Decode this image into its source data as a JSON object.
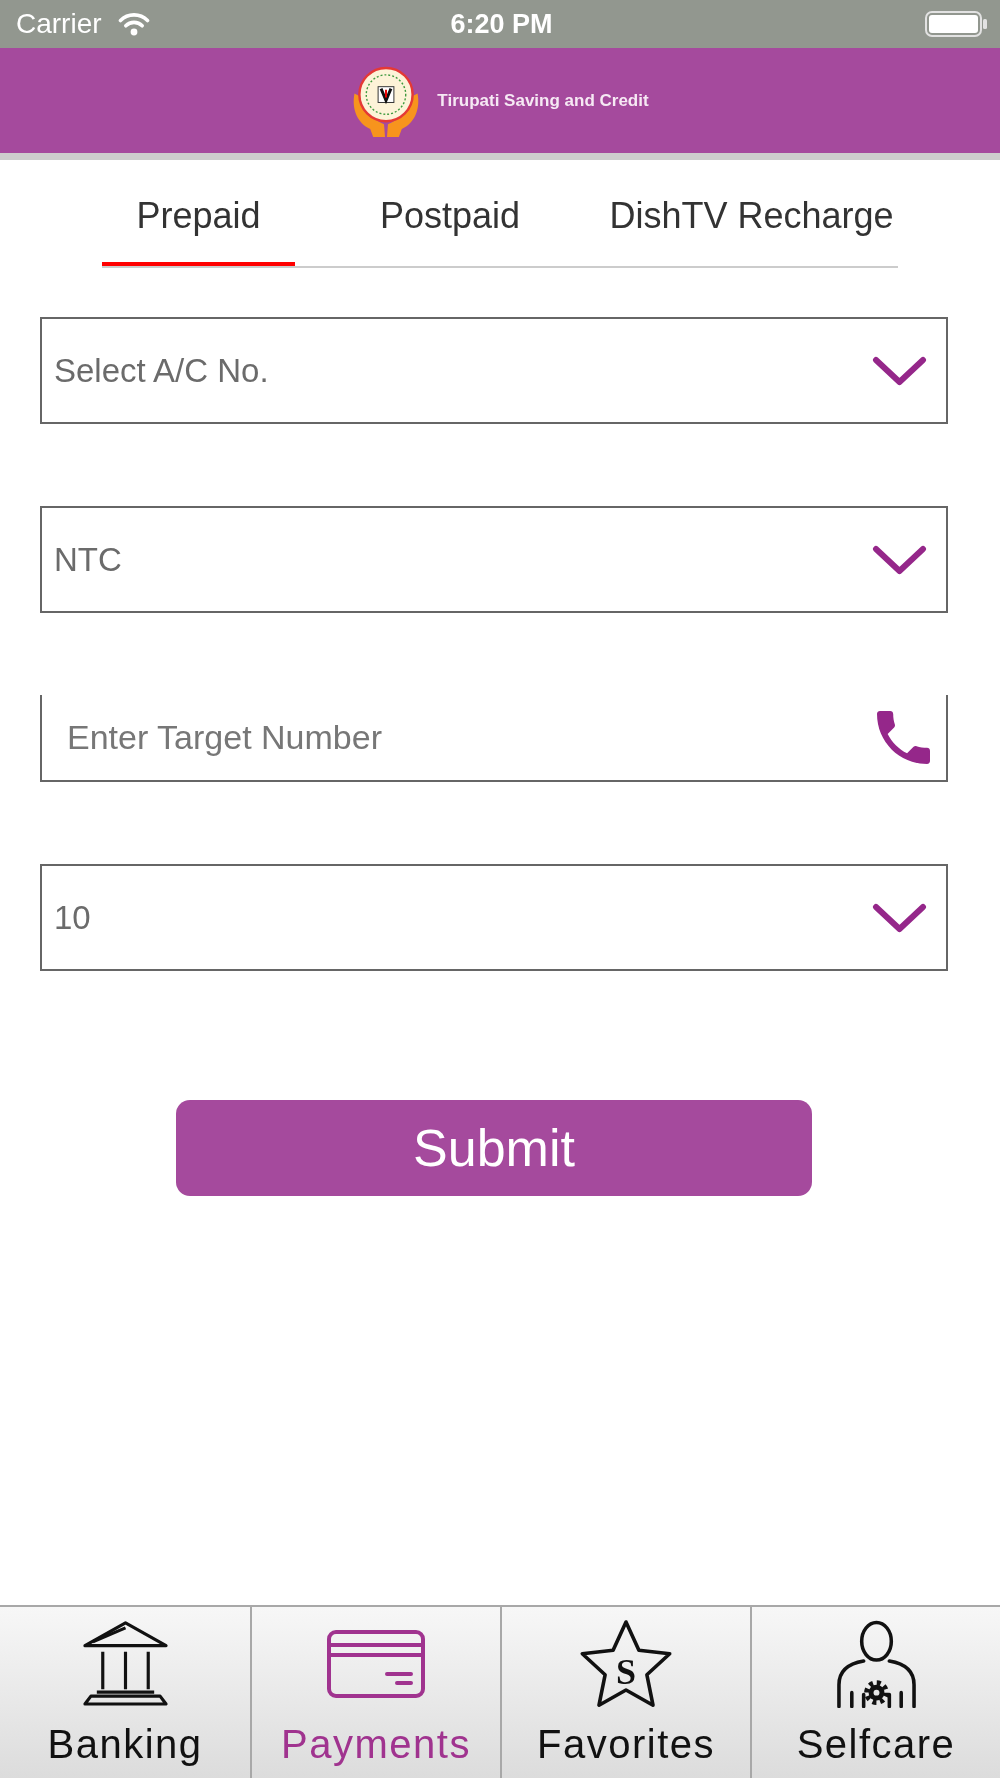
{
  "status_bar": {
    "carrier": "Carrier",
    "time": "6:20 PM"
  },
  "header": {
    "title": "Tirupati Saving and Credit"
  },
  "tabs": [
    {
      "label": "Prepaid",
      "selected": true
    },
    {
      "label": "Postpaid",
      "selected": false
    },
    {
      "label": "DishTV Recharge",
      "selected": false
    }
  ],
  "form": {
    "fields": [
      {
        "kind": "select",
        "value": "Select A/C No."
      },
      {
        "kind": "select",
        "value": "NTC"
      },
      {
        "kind": "phone",
        "placeholder": "Enter Target Number"
      },
      {
        "kind": "select",
        "value": "10"
      }
    ],
    "submit": "Submit"
  },
  "bottom_nav": [
    {
      "label": "Banking",
      "selected": false
    },
    {
      "label": "Payments",
      "selected": true
    },
    {
      "label": "Favorites",
      "selected": false,
      "icon_text": "S"
    },
    {
      "label": "Selfcare",
      "selected": false
    }
  ]
}
